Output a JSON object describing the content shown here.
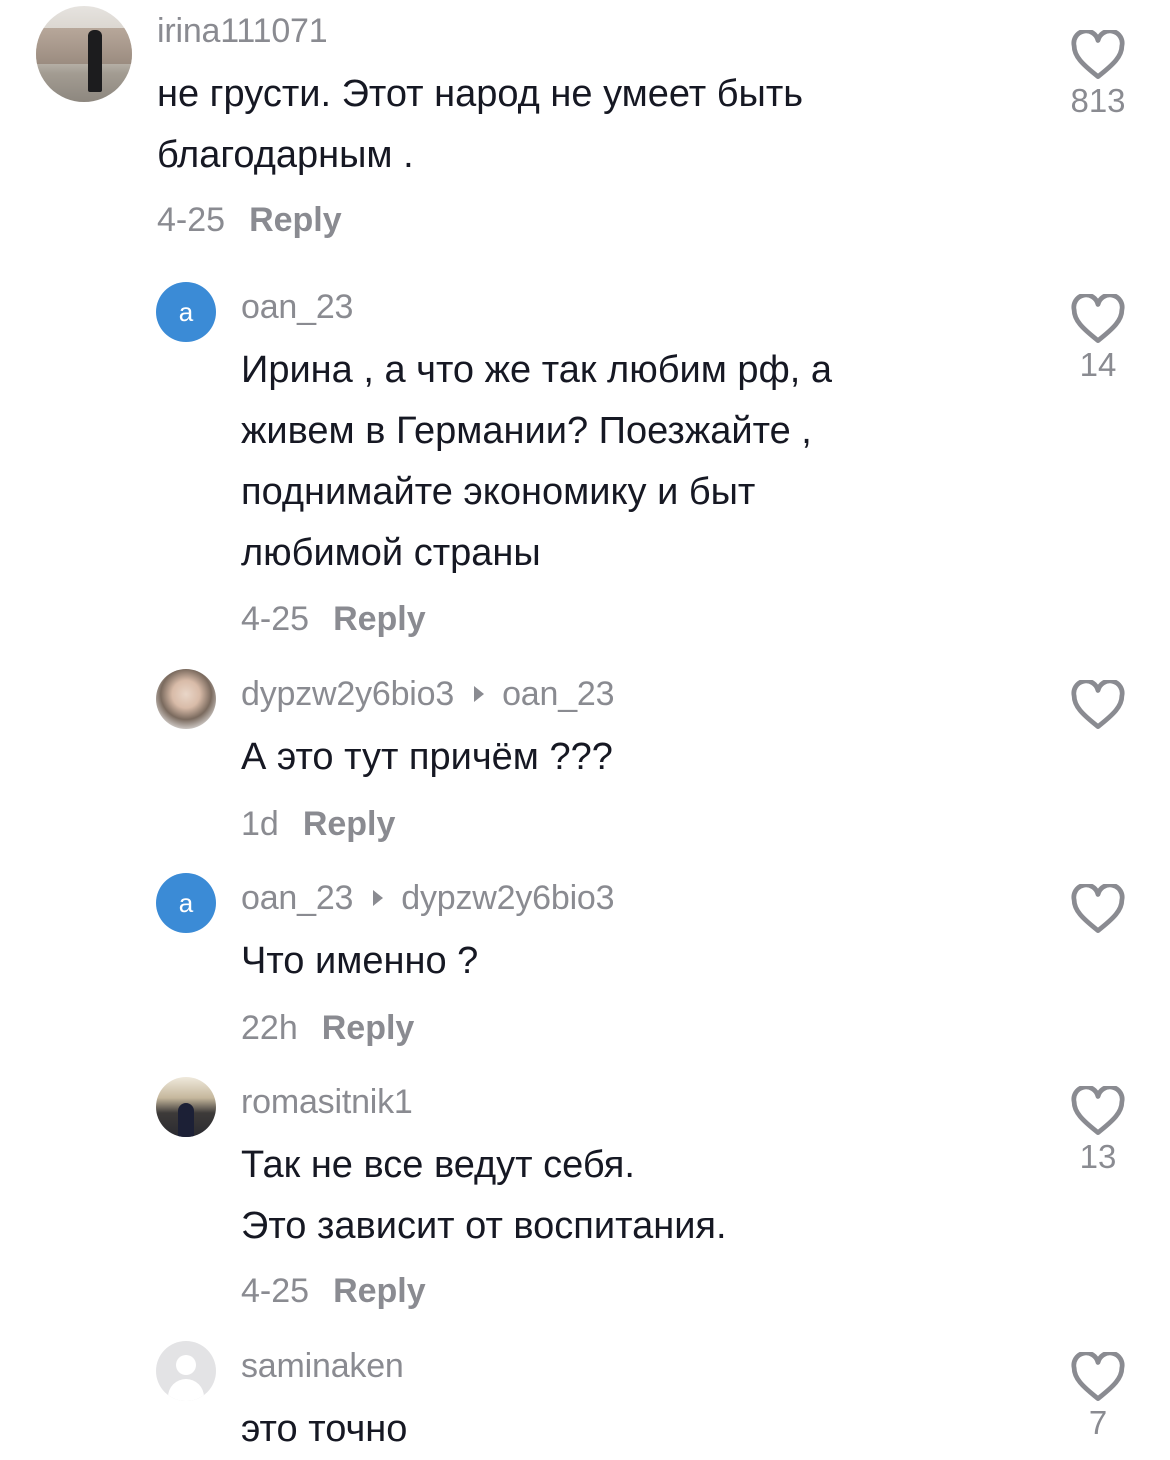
{
  "comments": [
    {
      "username": "irina111071",
      "text": "не грусти. Этот народ не умеет быть\nблагодарным .",
      "time": "4-25",
      "reply_label": "Reply",
      "likes": "813"
    },
    {
      "avatar_letter": "a",
      "username": "oan_23",
      "text": "Ирина , а что же так любим рф, а\nживем в Германии? Поезжайте ,\nподнимайте экономику и быт\nлюбимой страны",
      "time": "4-25",
      "reply_label": "Reply",
      "likes": "14"
    },
    {
      "username": "dypzw2y6bio3",
      "reply_to": "oan_23",
      "text": "А это тут причём ???",
      "time": "1d",
      "reply_label": "Reply",
      "likes": ""
    },
    {
      "avatar_letter": "a",
      "username": "oan_23",
      "reply_to": "dypzw2y6bio3",
      "text": "Что именно ?",
      "time": "22h",
      "reply_label": "Reply",
      "likes": ""
    },
    {
      "username": "romasitnik1",
      "text": "Так не все ведут себя.\nЭто зависит от воспитания.",
      "time": "4-25",
      "reply_label": "Reply",
      "likes": "13"
    },
    {
      "username": "saminaken",
      "text": "это точно",
      "likes": "7"
    }
  ],
  "icons": {
    "like": "heart-outline-icon",
    "reply_arrow": "triangle-right-icon",
    "default_avatar": "default-user-avatar-icon"
  },
  "colors": {
    "text": "#161823",
    "secondary": "#8a8b91",
    "avatar_letter_bg": "#3b8bd6",
    "background": "#ffffff"
  }
}
